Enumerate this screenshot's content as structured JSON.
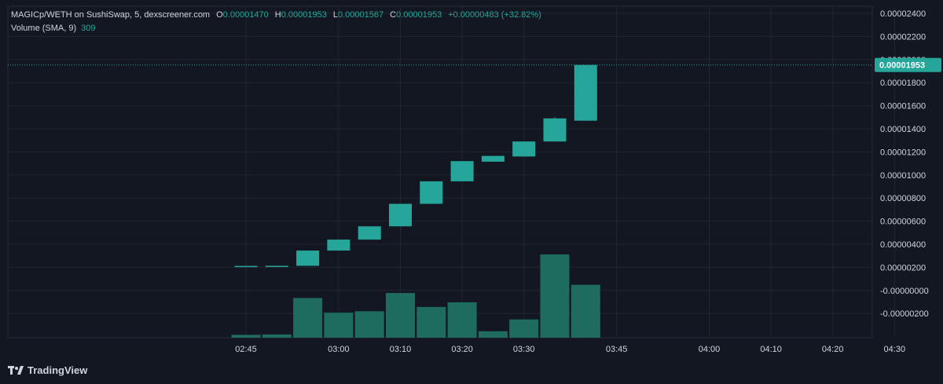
{
  "header": {
    "symbol": "MAGICp/WETH on SushiSwap, 5, dexscreener.com",
    "open_label": "O",
    "open": "0.00001470",
    "high_label": "H",
    "high": "0.00001953",
    "low_label": "L",
    "low": "0.00001567",
    "close_label": "C",
    "close": "0.00001953",
    "change": "+0.00000483 (+32.82%)",
    "volume_label": "Volume (SMA, 9)",
    "volume_value": "309"
  },
  "brand": {
    "name": "TradingView"
  },
  "colors": {
    "background": "#131722",
    "up": "#26a69a",
    "volume": "#1e6b5f",
    "grid": "#22262f",
    "text": "#d1d4dc"
  },
  "chart_data": {
    "type": "candlestick",
    "price_axis": {
      "ticks": [
        "0.00002400",
        "0.00002200",
        "0.00002000",
        "0.00001800",
        "0.00001600",
        "0.00001400",
        "0.00001200",
        "0.00001000",
        "0.00000800",
        "0.00000600",
        "0.00000400",
        "0.00000200",
        "-0.00000000",
        "-0.00000200"
      ],
      "tick_values": [
        2.4e-05,
        2.2e-05,
        2e-05,
        1.8e-05,
        1.6e-05,
        1.4e-05,
        1.2e-05,
        1e-05,
        8e-06,
        6e-06,
        4e-06,
        2e-06,
        0,
        -2e-06
      ],
      "current_price_label": "0.00001953",
      "current_price": 1.953e-05
    },
    "time_axis": {
      "ticks": [
        "02:45",
        "03:00",
        "03:10",
        "03:20",
        "03:30",
        "03:45",
        "04:00",
        "04:10",
        "04:20",
        "04:30"
      ],
      "tick_minutes": [
        165,
        180,
        190,
        200,
        210,
        225,
        240,
        250,
        260,
        270
      ]
    },
    "candles": [
      {
        "t": 165,
        "o": 2.1e-06,
        "h": 2.12e-06,
        "l": 2.08e-06,
        "c": 2.12e-06,
        "v": 8
      },
      {
        "t": 170,
        "o": 2.1e-06,
        "h": 2.13e-06,
        "l": 2.09e-06,
        "c": 2.13e-06,
        "v": 9
      },
      {
        "t": 175,
        "o": 2.13e-06,
        "h": 3.45e-06,
        "l": 2.13e-06,
        "c": 3.45e-06,
        "v": 111
      },
      {
        "t": 180,
        "o": 3.45e-06,
        "h": 4.4e-06,
        "l": 3.45e-06,
        "c": 4.4e-06,
        "v": 70
      },
      {
        "t": 185,
        "o": 4.4e-06,
        "h": 5.55e-06,
        "l": 4.4e-06,
        "c": 5.55e-06,
        "v": 74
      },
      {
        "t": 190,
        "o": 5.55e-06,
        "h": 7.5e-06,
        "l": 5.55e-06,
        "c": 7.5e-06,
        "v": 125
      },
      {
        "t": 195,
        "o": 7.5e-06,
        "h": 9.45e-06,
        "l": 7.5e-06,
        "c": 9.45e-06,
        "v": 86
      },
      {
        "t": 200,
        "o": 9.45e-06,
        "h": 1.12e-05,
        "l": 9.45e-06,
        "c": 1.12e-05,
        "v": 99
      },
      {
        "t": 205,
        "o": 1.115e-05,
        "h": 1.165e-05,
        "l": 1.115e-05,
        "c": 1.165e-05,
        "v": 18
      },
      {
        "t": 210,
        "o": 1.16e-05,
        "h": 1.29e-05,
        "l": 1.16e-05,
        "c": 1.29e-05,
        "v": 51
      },
      {
        "t": 215,
        "o": 1.29e-05,
        "h": 1.5e-05,
        "l": 1.29e-05,
        "c": 1.49e-05,
        "v": 233
      },
      {
        "t": 220,
        "o": 1.47e-05,
        "h": 1.953e-05,
        "l": 1.47e-05,
        "c": 1.953e-05,
        "v": 148
      }
    ]
  }
}
